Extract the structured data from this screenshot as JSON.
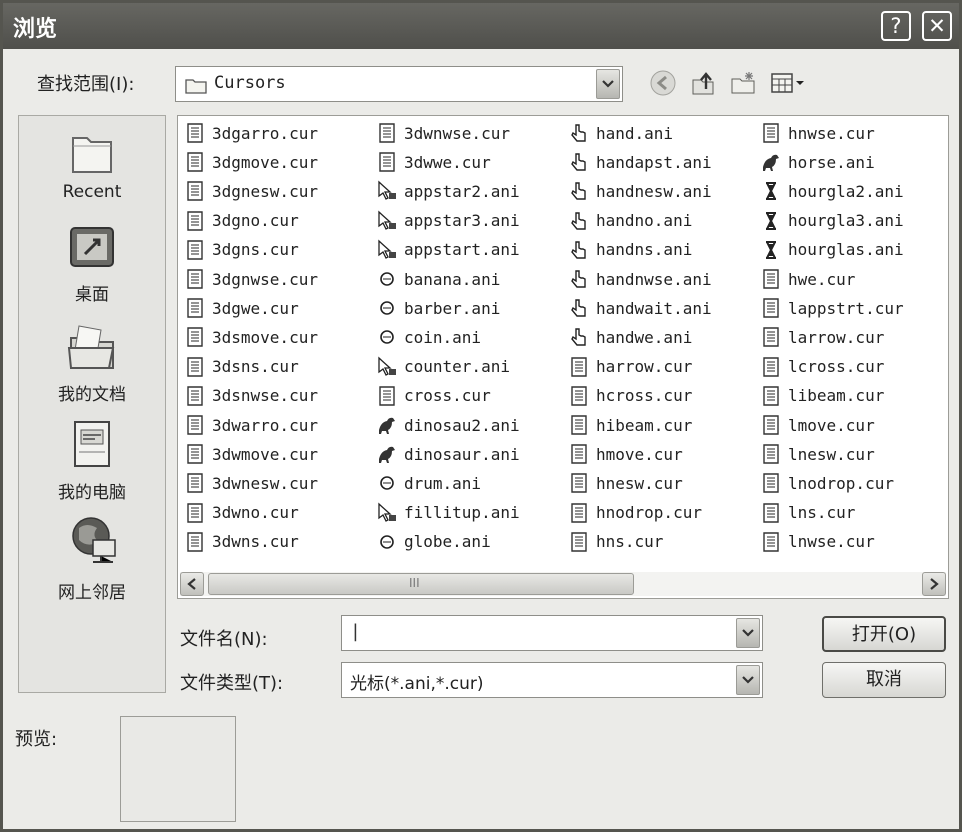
{
  "window": {
    "title": "浏览",
    "help_label": "?",
    "close_label": "✕"
  },
  "lookin": {
    "label": "查找范围(I):",
    "value": "Cursors"
  },
  "toolbar": {
    "icons": [
      "back-icon",
      "up-folder-icon",
      "new-folder-icon",
      "view-menu-icon"
    ]
  },
  "places": [
    {
      "label": "Recent",
      "icon": "recent-folder-icon"
    },
    {
      "label": "桌面",
      "icon": "desktop-icon"
    },
    {
      "label": "我的文档",
      "icon": "my-documents-icon"
    },
    {
      "label": "我的电脑",
      "icon": "my-computer-icon"
    },
    {
      "label": "网上邻居",
      "icon": "network-icon"
    }
  ],
  "files": {
    "columns": [
      [
        "3dgarro.cur",
        "3dgmove.cur",
        "3dgnesw.cur",
        "3dgno.cur",
        "3dgns.cur",
        "3dgnwse.cur",
        "3dgwe.cur",
        "3dsmove.cur",
        "3dsns.cur",
        "3dsnwse.cur",
        "3dwarro.cur",
        "3dwmove.cur",
        "3dwnesw.cur",
        "3dwno.cur",
        "3dwns.cur"
      ],
      [
        "3dwnwse.cur",
        "3dwwe.cur",
        "appstar2.ani",
        "appstar3.ani",
        "appstart.ani",
        "banana.ani",
        "barber.ani",
        "coin.ani",
        "counter.ani",
        "cross.cur",
        "dinosau2.ani",
        "dinosaur.ani",
        "drum.ani",
        "fillitup.ani",
        "globe.ani"
      ],
      [
        "hand.ani",
        "handapst.ani",
        "handnesw.ani",
        "handno.ani",
        "handns.ani",
        "handnwse.ani",
        "handwait.ani",
        "handwe.ani",
        "harrow.cur",
        "hcross.cur",
        "hibeam.cur",
        "hmove.cur",
        "hnesw.cur",
        "hnodrop.cur",
        "hns.cur"
      ],
      [
        "hnwse.cur",
        "horse.ani",
        "hourgla2.ani",
        "hourgla3.ani",
        "hourglas.ani",
        "hwe.cur",
        "lappstrt.cur",
        "larrow.cur",
        "lcross.cur",
        "libeam.cur",
        "lmove.cur",
        "lnesw.cur",
        "lnodrop.cur",
        "lns.cur",
        "lnwse.cur"
      ]
    ]
  },
  "filename": {
    "label": "文件名(N):",
    "value": "|"
  },
  "filetype": {
    "label": "文件类型(T):",
    "value": "光标(*.ani,*.cur)"
  },
  "buttons": {
    "open": "打开(O)",
    "cancel": "取消"
  },
  "preview": {
    "label": "预览:"
  },
  "scrollbar": {
    "grip": "III"
  }
}
